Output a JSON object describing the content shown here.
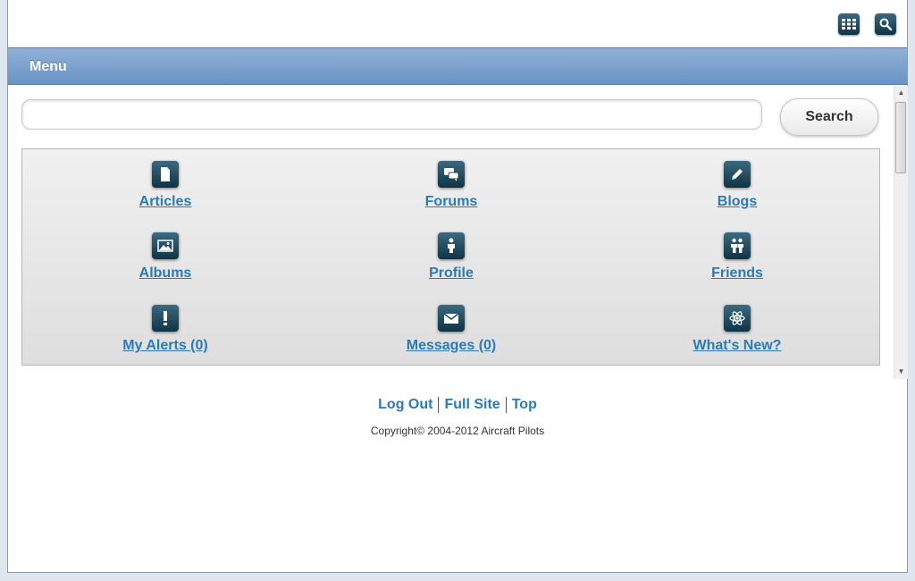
{
  "header": {
    "menu_title": "Menu"
  },
  "search": {
    "value": "",
    "placeholder": "",
    "button_label": "Search"
  },
  "menu_items": [
    {
      "label": "Articles",
      "icon": "document-icon"
    },
    {
      "label": "Forums",
      "icon": "speech-bubbles-icon"
    },
    {
      "label": "Blogs",
      "icon": "pencil-icon"
    },
    {
      "label": "Albums",
      "icon": "image-icon"
    },
    {
      "label": "Profile",
      "icon": "person-icon"
    },
    {
      "label": "Friends",
      "icon": "friends-icon"
    },
    {
      "label": "My Alerts (0)",
      "icon": "exclamation-icon"
    },
    {
      "label": "Messages (0)",
      "icon": "envelope-icon"
    },
    {
      "label": "What's New?",
      "icon": "atom-icon"
    }
  ],
  "footer": {
    "links": [
      "Log Out",
      "Full Site",
      "Top"
    ],
    "copyright": "Copyright© 2004-2012 Aircraft Pilots"
  },
  "colors": {
    "link": "#2b7bb9",
    "menubar": "#7aa1cd",
    "icon_bg": "#1f4a5e"
  }
}
